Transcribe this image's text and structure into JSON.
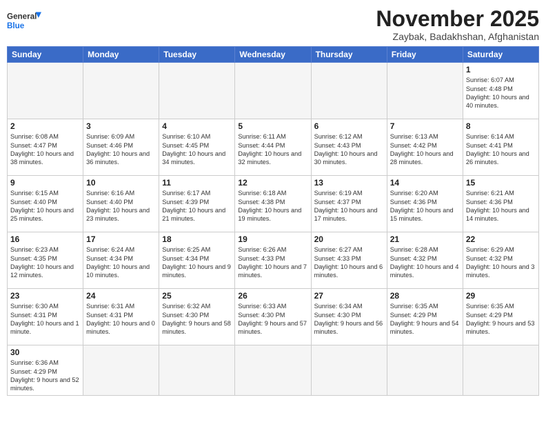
{
  "logo": {
    "line1": "General",
    "line2": "Blue"
  },
  "title": "November 2025",
  "subtitle": "Zaybak, Badakhshan, Afghanistan",
  "headers": [
    "Sunday",
    "Monday",
    "Tuesday",
    "Wednesday",
    "Thursday",
    "Friday",
    "Saturday"
  ],
  "weeks": [
    [
      {
        "day": "",
        "info": ""
      },
      {
        "day": "",
        "info": ""
      },
      {
        "day": "",
        "info": ""
      },
      {
        "day": "",
        "info": ""
      },
      {
        "day": "",
        "info": ""
      },
      {
        "day": "",
        "info": ""
      },
      {
        "day": "1",
        "info": "Sunrise: 6:07 AM\nSunset: 4:48 PM\nDaylight: 10 hours\nand 40 minutes."
      }
    ],
    [
      {
        "day": "2",
        "info": "Sunrise: 6:08 AM\nSunset: 4:47 PM\nDaylight: 10 hours\nand 38 minutes."
      },
      {
        "day": "3",
        "info": "Sunrise: 6:09 AM\nSunset: 4:46 PM\nDaylight: 10 hours\nand 36 minutes."
      },
      {
        "day": "4",
        "info": "Sunrise: 6:10 AM\nSunset: 4:45 PM\nDaylight: 10 hours\nand 34 minutes."
      },
      {
        "day": "5",
        "info": "Sunrise: 6:11 AM\nSunset: 4:44 PM\nDaylight: 10 hours\nand 32 minutes."
      },
      {
        "day": "6",
        "info": "Sunrise: 6:12 AM\nSunset: 4:43 PM\nDaylight: 10 hours\nand 30 minutes."
      },
      {
        "day": "7",
        "info": "Sunrise: 6:13 AM\nSunset: 4:42 PM\nDaylight: 10 hours\nand 28 minutes."
      },
      {
        "day": "8",
        "info": "Sunrise: 6:14 AM\nSunset: 4:41 PM\nDaylight: 10 hours\nand 26 minutes."
      }
    ],
    [
      {
        "day": "9",
        "info": "Sunrise: 6:15 AM\nSunset: 4:40 PM\nDaylight: 10 hours\nand 25 minutes."
      },
      {
        "day": "10",
        "info": "Sunrise: 6:16 AM\nSunset: 4:40 PM\nDaylight: 10 hours\nand 23 minutes."
      },
      {
        "day": "11",
        "info": "Sunrise: 6:17 AM\nSunset: 4:39 PM\nDaylight: 10 hours\nand 21 minutes."
      },
      {
        "day": "12",
        "info": "Sunrise: 6:18 AM\nSunset: 4:38 PM\nDaylight: 10 hours\nand 19 minutes."
      },
      {
        "day": "13",
        "info": "Sunrise: 6:19 AM\nSunset: 4:37 PM\nDaylight: 10 hours\nand 17 minutes."
      },
      {
        "day": "14",
        "info": "Sunrise: 6:20 AM\nSunset: 4:36 PM\nDaylight: 10 hours\nand 15 minutes."
      },
      {
        "day": "15",
        "info": "Sunrise: 6:21 AM\nSunset: 4:36 PM\nDaylight: 10 hours\nand 14 minutes."
      }
    ],
    [
      {
        "day": "16",
        "info": "Sunrise: 6:23 AM\nSunset: 4:35 PM\nDaylight: 10 hours\nand 12 minutes."
      },
      {
        "day": "17",
        "info": "Sunrise: 6:24 AM\nSunset: 4:34 PM\nDaylight: 10 hours\nand 10 minutes."
      },
      {
        "day": "18",
        "info": "Sunrise: 6:25 AM\nSunset: 4:34 PM\nDaylight: 10 hours\nand 9 minutes."
      },
      {
        "day": "19",
        "info": "Sunrise: 6:26 AM\nSunset: 4:33 PM\nDaylight: 10 hours\nand 7 minutes."
      },
      {
        "day": "20",
        "info": "Sunrise: 6:27 AM\nSunset: 4:33 PM\nDaylight: 10 hours\nand 6 minutes."
      },
      {
        "day": "21",
        "info": "Sunrise: 6:28 AM\nSunset: 4:32 PM\nDaylight: 10 hours\nand 4 minutes."
      },
      {
        "day": "22",
        "info": "Sunrise: 6:29 AM\nSunset: 4:32 PM\nDaylight: 10 hours\nand 3 minutes."
      }
    ],
    [
      {
        "day": "23",
        "info": "Sunrise: 6:30 AM\nSunset: 4:31 PM\nDaylight: 10 hours\nand 1 minute."
      },
      {
        "day": "24",
        "info": "Sunrise: 6:31 AM\nSunset: 4:31 PM\nDaylight: 10 hours\nand 0 minutes."
      },
      {
        "day": "25",
        "info": "Sunrise: 6:32 AM\nSunset: 4:30 PM\nDaylight: 9 hours\nand 58 minutes."
      },
      {
        "day": "26",
        "info": "Sunrise: 6:33 AM\nSunset: 4:30 PM\nDaylight: 9 hours\nand 57 minutes."
      },
      {
        "day": "27",
        "info": "Sunrise: 6:34 AM\nSunset: 4:30 PM\nDaylight: 9 hours\nand 56 minutes."
      },
      {
        "day": "28",
        "info": "Sunrise: 6:35 AM\nSunset: 4:29 PM\nDaylight: 9 hours\nand 54 minutes."
      },
      {
        "day": "29",
        "info": "Sunrise: 6:35 AM\nSunset: 4:29 PM\nDaylight: 9 hours\nand 53 minutes."
      }
    ],
    [
      {
        "day": "30",
        "info": "Sunrise: 6:36 AM\nSunset: 4:29 PM\nDaylight: 9 hours\nand 52 minutes."
      },
      {
        "day": "",
        "info": ""
      },
      {
        "day": "",
        "info": ""
      },
      {
        "day": "",
        "info": ""
      },
      {
        "day": "",
        "info": ""
      },
      {
        "day": "",
        "info": ""
      },
      {
        "day": "",
        "info": ""
      }
    ]
  ]
}
